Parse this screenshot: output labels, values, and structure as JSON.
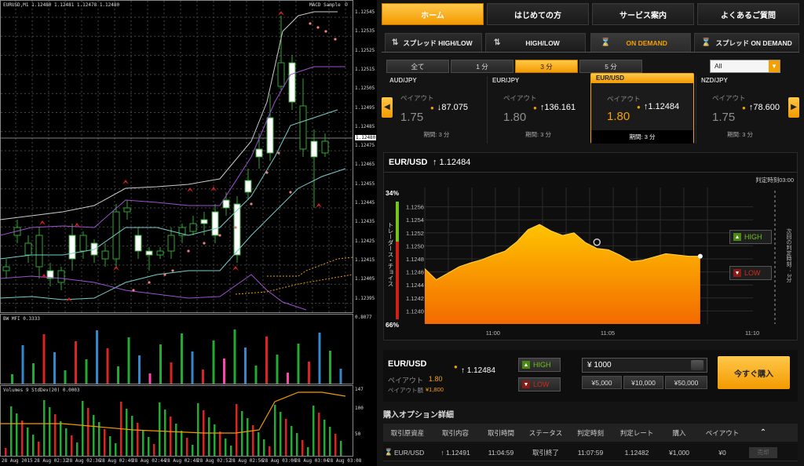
{
  "mt4": {
    "chart_header": "EURUSD,M1  1.12480 1.12481 1.12478 1.12480",
    "ea_label": "MACD Sample",
    "price_ticks": [
      "1.12545",
      "1.12535",
      "1.12525",
      "1.12515",
      "1.12505",
      "1.12495",
      "1.12485",
      "1.12475",
      "1.12465",
      "1.12455",
      "1.12445",
      "1.12435",
      "1.12425",
      "1.12415",
      "1.12405",
      "1.12395"
    ],
    "current_price_label": "1.12480",
    "mfi_header": "BW MFI 0.3333",
    "mfi_scale_top": "0.8077",
    "volumes_header": "Volumes 9  StdDev(20) 0.0003",
    "volumes_scale_top": "147",
    "volumes_scale_mid": "100",
    "volumes_scale_low": "50",
    "time_ticks": [
      "28 Aug 2015",
      "28 Aug 02:32",
      "28 Aug 02:36",
      "28 Aug 02:40",
      "28 Aug 02:44",
      "28 Aug 02:48",
      "28 Aug 02:52",
      "28 Aug 02:56",
      "28 Aug 03:00",
      "28 Aug 03:04",
      "28 Aug 03:08"
    ]
  },
  "platform": {
    "nav": [
      "ホーム",
      "はじめての方",
      "サービス案内",
      "よくあるご質問"
    ],
    "modes": [
      {
        "label": "スプレッド HIGH/LOW",
        "icon": "⇅"
      },
      {
        "label": "HIGH/LOW",
        "icon": "⇅"
      },
      {
        "label": "ON DEMAND",
        "icon": "⌛"
      },
      {
        "label": "スプレッド ON DEMAND",
        "icon": "⌛"
      }
    ],
    "durations": [
      "全て",
      "1 分",
      "3 分",
      "5 分"
    ],
    "filter_value": "All",
    "cards": [
      {
        "pair": "AUD/JPY",
        "payout_label": "ペイアウト",
        "payout": "1.75",
        "rate": "↓87.075",
        "period": "期間: 3 分"
      },
      {
        "pair": "EUR/JPY",
        "payout_label": "ペイアウト",
        "payout": "1.80",
        "rate": "↑136.161",
        "period": "期間: 3 分"
      },
      {
        "pair": "EUR/USD",
        "payout_label": "ペイアウト",
        "payout": "1.80",
        "rate": "↑1.12484",
        "period": "期間: 3 分"
      },
      {
        "pair": "NZD/JPY",
        "payout_label": "ペイアウト",
        "payout": "1.75",
        "rate": "↑78.600",
        "period": "期間: 3 分"
      }
    ],
    "chart_title_pair": "EUR/USD",
    "chart_title_rate": "↑ 1.12484",
    "expiry_label": "判定時刻03:00",
    "sentiment_label": "トレーダース・チョイス",
    "sentiment_top": "34%",
    "sentiment_bottom": "66%",
    "next_expiry_label": "次回の判定時刻： 3分",
    "high_label": "HIGH",
    "low_label": "LOW",
    "order": {
      "pair": "EUR/USD",
      "rate": "↑ 1.12484",
      "payout_label": "ペイアウト",
      "payout_value": "1.80",
      "payout_amount_label": "ペイアウト額",
      "payout_amount": "¥1,800",
      "high": "HIGH",
      "low": "LOW",
      "amount": "¥ 1000",
      "quick_amounts": [
        "¥5,000",
        "¥10,000",
        "¥50,000"
      ],
      "buy_label": "今すぐ購入"
    },
    "details_title": "購入オプション詳細",
    "table_headers": [
      "取引原資産",
      "取引内容",
      "取引時間",
      "ステータス",
      "判定時刻",
      "判定レート",
      "購入",
      "ペイアウト"
    ],
    "table_row": [
      "EUR/USD",
      "↑ 1.12491",
      "11:04:59",
      "取引終了",
      "11:07:59",
      "1.12482",
      "¥1,000",
      "¥0"
    ],
    "row_button": "売却"
  },
  "chart_data": {
    "type": "area",
    "title": "EUR/USD",
    "xlabel": "",
    "ylabel": "",
    "x_ticks": [
      "11:00",
      "11:05",
      "11:10"
    ],
    "y_ticks": [
      "1.1256",
      "1.1254",
      "1.1252",
      "1.1250",
      "1.1248",
      "1.1246",
      "1.1244",
      "1.1242",
      "1.1240"
    ],
    "ylim": [
      1.1238,
      1.1258
    ],
    "x_minutes": [
      0,
      0.5,
      1,
      1.5,
      2,
      2.5,
      3,
      3.5,
      4,
      4.5,
      5,
      5.5,
      6,
      6.5,
      7,
      7.5,
      8,
      8.5,
      9,
      9.5,
      10,
      10.5,
      11,
      11.5,
      12
    ],
    "values": [
      1.12465,
      1.12448,
      1.12458,
      1.12468,
      1.12474,
      1.12479,
      1.12486,
      1.12492,
      1.12506,
      1.12525,
      1.12533,
      1.12523,
      1.12516,
      1.1252,
      1.12505,
      1.12496,
      1.12494,
      1.12486,
      1.12476,
      1.12478,
      1.12483,
      1.12488,
      1.12486,
      1.12484,
      1.12484
    ],
    "colors": {
      "fill_top": "#ffc400",
      "fill_bottom": "#f36a00",
      "line": "#ffd54a"
    }
  },
  "colors": {
    "accent": "#f3a000",
    "high": "#6cc417",
    "low": "#d22a1a"
  }
}
